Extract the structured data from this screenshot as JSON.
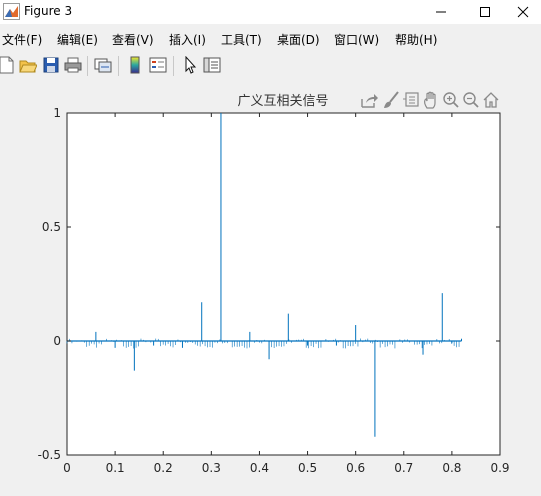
{
  "window": {
    "title": "Figure 3",
    "controls": {
      "minimize": "minimize",
      "maximize": "maximize",
      "close": "close"
    }
  },
  "menu": {
    "items": [
      "文件(F)",
      "编辑(E)",
      "查看(V)",
      "插入(I)",
      "工具(T)",
      "桌面(D)",
      "窗口(W)",
      "帮助(H)"
    ]
  },
  "toolbar": {
    "icons": [
      "new-figure-icon",
      "open-file-icon",
      "save-icon",
      "print-icon",
      "link-plot-icon",
      "colorbar-icon",
      "legend-icon",
      "edit-plot-icon",
      "property-inspector-icon"
    ]
  },
  "axes_toolbar": {
    "icons": [
      "export-icon",
      "brush-icon",
      "data-tips-icon",
      "pan-icon",
      "zoom-in-icon",
      "zoom-out-icon",
      "home-icon"
    ]
  },
  "colors": {
    "line": "#0072bd",
    "axes_bg": "#ffffff",
    "figure_bg": "#f0f0f0",
    "axis": "#262626"
  },
  "chart_data": {
    "type": "line",
    "title": "广义互相关信号",
    "xlabel": "",
    "ylabel": "",
    "xlim": [
      0,
      0.9
    ],
    "ylim": [
      -0.5,
      1
    ],
    "xticks": [
      0,
      0.1,
      0.2,
      0.3,
      0.4,
      0.5,
      0.6,
      0.7,
      0.8,
      0.9
    ],
    "xtick_labels": [
      "0",
      "0.1",
      "0.2",
      "0.3",
      "0.4",
      "0.5",
      "0.6",
      "0.7",
      "0.8",
      "0.9"
    ],
    "yticks": [
      -0.5,
      0,
      0.5,
      1
    ],
    "ytick_labels": [
      "-0.5",
      "0",
      "0.5",
      "1"
    ],
    "grid": false,
    "baseline_range": [
      0,
      0.82
    ],
    "series": [
      {
        "x": [
          0.06,
          0.1,
          0.14,
          0.18,
          0.24,
          0.28,
          0.32,
          0.38,
          0.42,
          0.46,
          0.5,
          0.56,
          0.6,
          0.64,
          0.74,
          0.78,
          0.8,
          0.82
        ],
        "values": [
          0.04,
          -0.03,
          -0.13,
          -0.02,
          -0.03,
          0.17,
          1.0,
          0.04,
          -0.08,
          0.12,
          -0.02,
          -0.02,
          0.07,
          -0.42,
          -0.06,
          0.21,
          -0.01,
          0.01
        ]
      }
    ]
  }
}
